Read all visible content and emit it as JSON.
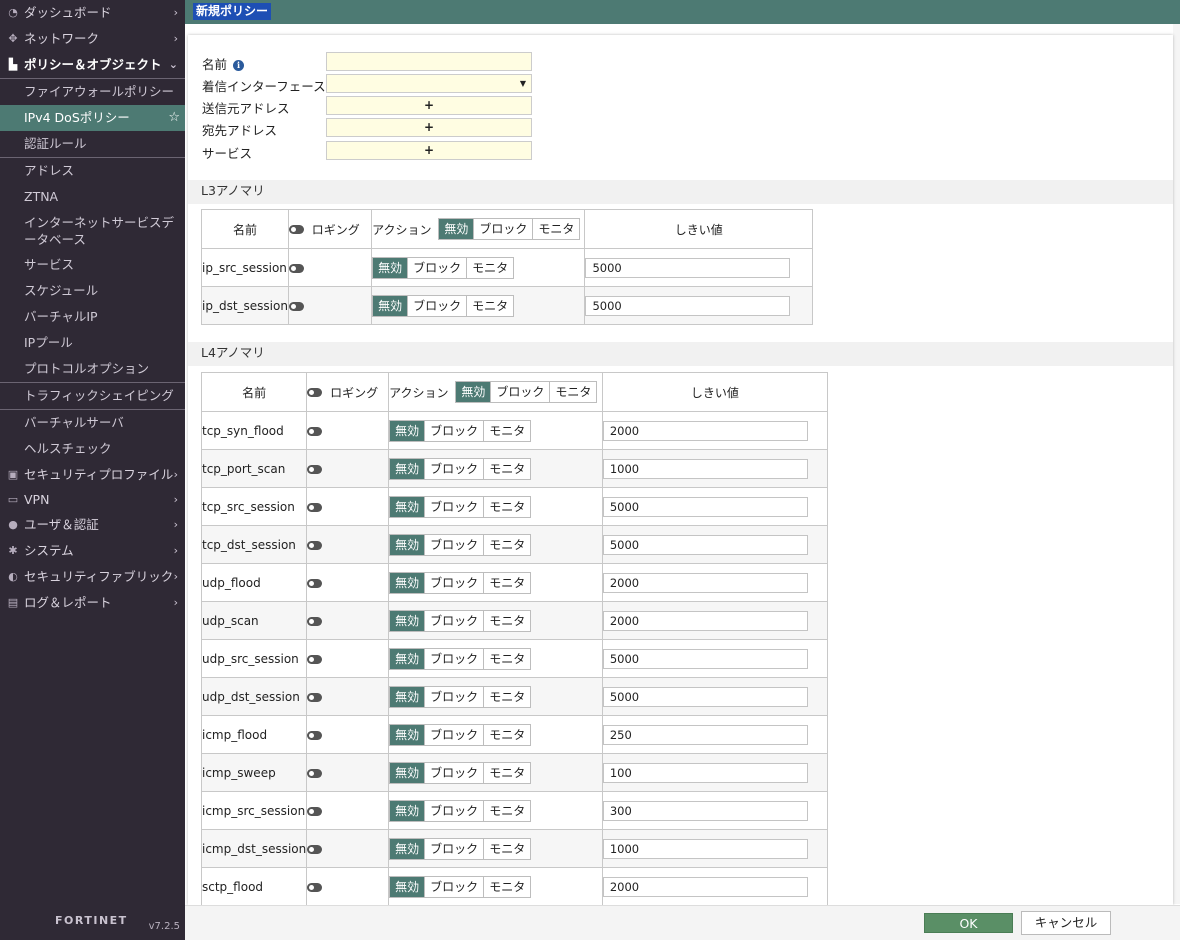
{
  "sidebar": {
    "items": [
      {
        "label": "ダッシュボード",
        "icon": "dashboard-icon"
      },
      {
        "label": "ネットワーク",
        "icon": "network-icon"
      },
      {
        "label": "ポリシー＆オブジェクト",
        "icon": "policy-icon"
      }
    ],
    "policy_sub": [
      "ファイアウォールポリシー",
      "IPv4 DoSポリシー",
      "認証ルール",
      "アドレス",
      "ZTNA",
      "インターネットサービスデータベース",
      "サービス",
      "スケジュール",
      "バーチャルIP",
      "IPプール",
      "プロトコルオプション",
      "トラフィックシェイピング",
      "バーチャルサーバ",
      "ヘルスチェック"
    ],
    "items_after": [
      {
        "label": "セキュリティプロファイル",
        "icon": "lock-icon"
      },
      {
        "label": "VPN",
        "icon": "laptop-icon"
      },
      {
        "label": "ユーザ＆認証",
        "icon": "user-icon"
      },
      {
        "label": "システム",
        "icon": "gear-icon"
      },
      {
        "label": "セキュリティファブリック",
        "icon": "fabric-icon"
      },
      {
        "label": "ログ＆レポート",
        "icon": "chart-icon"
      }
    ],
    "logo": "FORTINET",
    "version": "v7.2.5"
  },
  "header": {
    "title": "新規ポリシー"
  },
  "form": {
    "name_label": "名前",
    "incoming_label": "着信インターフェース",
    "src_label": "送信元アドレス",
    "dst_label": "宛先アドレス",
    "service_label": "サービス",
    "add_symbol": "+"
  },
  "table_headers": {
    "name": "名前",
    "logging": "ロギング",
    "action": "アクション",
    "threshold": "しきい値",
    "disable": "無効",
    "block": "ブロック",
    "monitor": "モニタ"
  },
  "l3": {
    "title": "L3アノマリ",
    "rows": [
      {
        "name": "ip_src_session",
        "threshold": "5000"
      },
      {
        "name": "ip_dst_session",
        "threshold": "5000"
      }
    ]
  },
  "l4": {
    "title": "L4アノマリ",
    "rows": [
      {
        "name": "tcp_syn_flood",
        "threshold": "2000"
      },
      {
        "name": "tcp_port_scan",
        "threshold": "1000"
      },
      {
        "name": "tcp_src_session",
        "threshold": "5000"
      },
      {
        "name": "tcp_dst_session",
        "threshold": "5000"
      },
      {
        "name": "udp_flood",
        "threshold": "2000"
      },
      {
        "name": "udp_scan",
        "threshold": "2000"
      },
      {
        "name": "udp_src_session",
        "threshold": "5000"
      },
      {
        "name": "udp_dst_session",
        "threshold": "5000"
      },
      {
        "name": "icmp_flood",
        "threshold": "250"
      },
      {
        "name": "icmp_sweep",
        "threshold": "100"
      },
      {
        "name": "icmp_src_session",
        "threshold": "300"
      },
      {
        "name": "icmp_dst_session",
        "threshold": "1000"
      },
      {
        "name": "sctp_flood",
        "threshold": "2000"
      }
    ]
  },
  "footer": {
    "ok": "OK",
    "cancel": "キャンセル"
  },
  "colors": {
    "accent": "#4d7a73",
    "ok": "#5a8f66",
    "sidebar": "#2f2935",
    "input_bg": "#fffde2"
  }
}
